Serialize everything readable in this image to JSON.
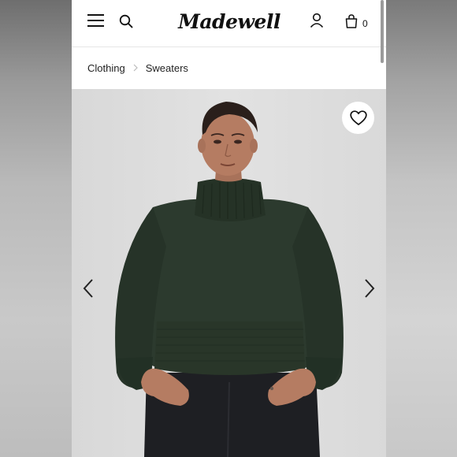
{
  "header": {
    "logo": "Madewell",
    "bag_count": "0"
  },
  "breadcrumb": {
    "items": [
      "Clothing",
      "Sweaters"
    ]
  },
  "product": {
    "icons": {
      "wishlist": "heart-icon",
      "prev": "chevron-left-icon",
      "next": "chevron-right-icon"
    },
    "colors": {
      "sweater": "#2c3a2e",
      "background": "#e0e0e0"
    }
  }
}
